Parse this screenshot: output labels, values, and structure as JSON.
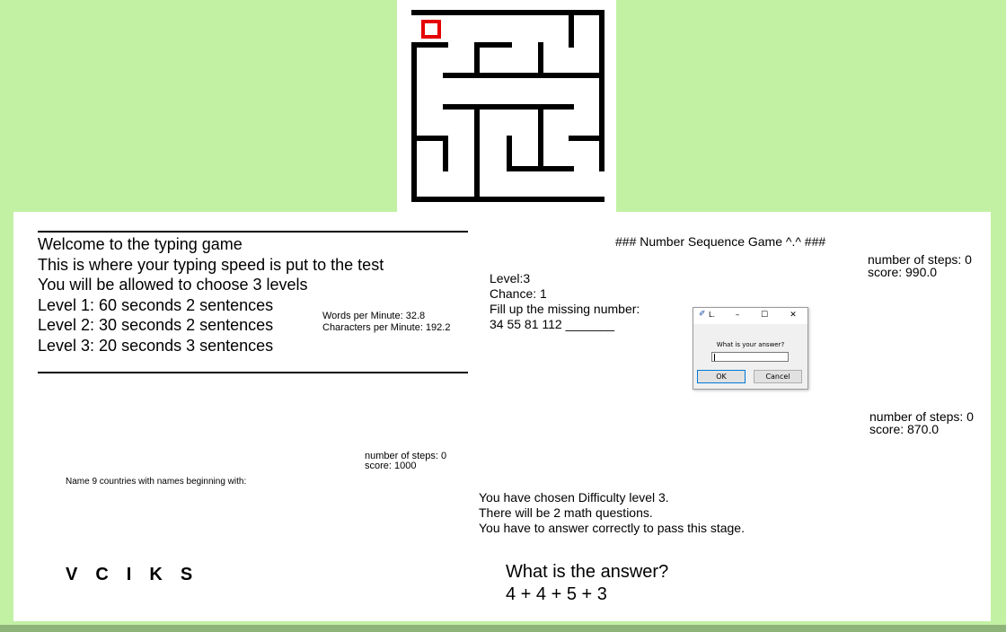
{
  "maze": {
    "player_color": "#e60000"
  },
  "typing_game": {
    "lines": [
      "Welcome to the typing game",
      "This is where your typing speed is put to the test",
      "You will be allowed to choose 3 levels",
      "Level 1: 60 seconds 2 sentences",
      "Level 2: 30 seconds 2 sentences",
      "Level 3: 20 seconds 3 sentences"
    ],
    "wpm": "Words per Minute: 32.8",
    "cpm": "Characters per Minute: 192.2"
  },
  "number_sequence": {
    "title": "### Number Sequence Game ^.^ ###",
    "steps": "number of steps: 0",
    "score": "score: 990.0",
    "level": "Level:3",
    "chance": "Chance: 1",
    "instruction": "Fill up the missing number:",
    "sequence": "34 55 81 112 _______",
    "dialog": {
      "title": "L.",
      "prompt": "What is your answer?",
      "value": "",
      "ok_label": "OK",
      "cancel_label": "Cancel",
      "minimize_glyph": "–",
      "maximize_glyph": "☐",
      "close_glyph": "✕"
    }
  },
  "countries_game": {
    "steps": "number of steps: 0",
    "score": "score: 1000",
    "prompt": "Name 9 countries with names beginning with:",
    "letters": [
      "V",
      "C",
      "I",
      "K",
      "S"
    ]
  },
  "math_game": {
    "steps": "number of steps: 0",
    "score": "score: 870.0",
    "lines": [
      "You have chosen Difficulty level 3.",
      "There will be 2 math questions.",
      "You have to answer correctly to pass this stage."
    ],
    "question": "What is the answer?",
    "expression": "4 + 4 + 5 + 3"
  }
}
